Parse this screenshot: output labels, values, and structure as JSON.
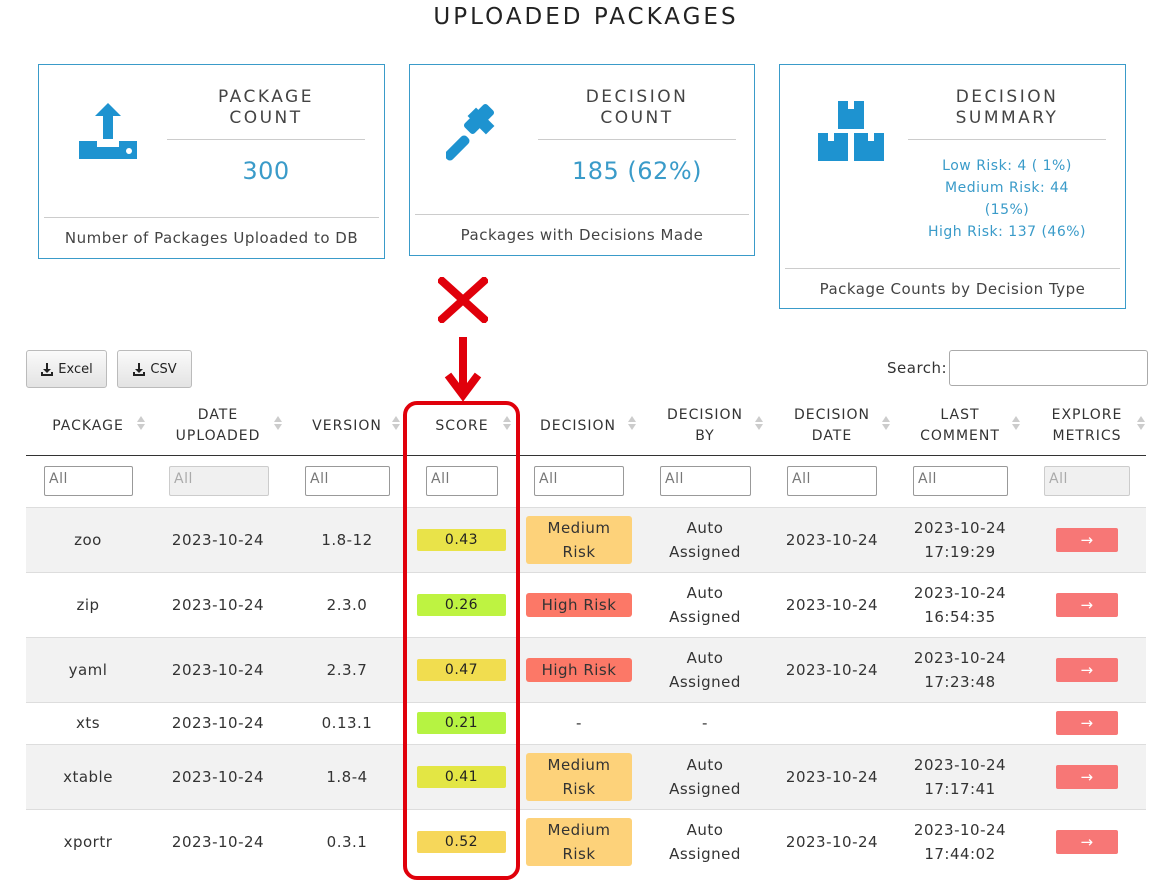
{
  "page": {
    "title": "UPLOADED PACKAGES"
  },
  "cards": {
    "package_count": {
      "title_line1": "PACKAGE",
      "title_line2": "COUNT",
      "value": "300",
      "footer": "Number of Packages Uploaded to DB",
      "icon": "upload-icon"
    },
    "decision_count": {
      "title_line1": "DECISION",
      "title_line2": "COUNT",
      "value": "185 (62%)",
      "footer": "Packages with Decisions Made",
      "icon": "gavel-icon"
    },
    "decision_summary": {
      "title_line1": "DECISION",
      "title_line2": "SUMMARY",
      "low": "Low Risk: 4 ( 1%)",
      "medium_line1": "Medium Risk: 44",
      "medium_line2": "(15%)",
      "high": "High Risk: 137 (46%)",
      "footer": "Package Counts by Decision Type",
      "icon": "boxes-icon"
    }
  },
  "toolbar": {
    "excel_label": "Excel",
    "csv_label": "CSV",
    "search_label": "Search:",
    "search_value": ""
  },
  "table": {
    "headers": {
      "package": "PACKAGE",
      "date_uploaded_1": "DATE",
      "date_uploaded_2": "UPLOADED",
      "version": "VERSION",
      "score": "SCORE",
      "decision": "DECISION",
      "decision_by_1": "DECISION",
      "decision_by_2": "BY",
      "decision_date_1": "DECISION",
      "decision_date_2": "DATE",
      "last_comment_1": "LAST",
      "last_comment_2": "COMMENT",
      "explore_1": "EXPLORE",
      "explore_2": "METRICS"
    },
    "filter_placeholder": "All",
    "rows": [
      {
        "package": "zoo",
        "date": "2023-10-24",
        "version": "1.8-12",
        "score": "0.43",
        "score_color": "#e9e349",
        "decision_1": "Medium",
        "decision_2": "Risk",
        "decision_color": "#fdd27a",
        "by_1": "Auto",
        "by_2": "Assigned",
        "decision_date": "2023-10-24",
        "comment_1": "2023-10-24",
        "comment_2": "17:19:29",
        "explore": "→"
      },
      {
        "package": "zip",
        "date": "2023-10-24",
        "version": "2.3.0",
        "score": "0.26",
        "score_color": "#bef341",
        "decision_1": "High Risk",
        "decision_2": "",
        "decision_color": "#fc7867",
        "by_1": "Auto",
        "by_2": "Assigned",
        "decision_date": "2023-10-24",
        "comment_1": "2023-10-24",
        "comment_2": "16:54:35",
        "explore": "→"
      },
      {
        "package": "yaml",
        "date": "2023-10-24",
        "version": "2.3.7",
        "score": "0.47",
        "score_color": "#f1dd4f",
        "decision_1": "High Risk",
        "decision_2": "",
        "decision_color": "#fc7867",
        "by_1": "Auto",
        "by_2": "Assigned",
        "decision_date": "2023-10-24",
        "comment_1": "2023-10-24",
        "comment_2": "17:23:48",
        "explore": "→"
      },
      {
        "package": "xts",
        "date": "2023-10-24",
        "version": "0.13.1",
        "score": "0.21",
        "score_color": "#b6f342",
        "decision_1": "-",
        "decision_2": "",
        "decision_color": "",
        "by_1": "-",
        "by_2": "",
        "decision_date": "",
        "comment_1": "",
        "comment_2": "",
        "explore": "→"
      },
      {
        "package": "xtable",
        "date": "2023-10-24",
        "version": "1.8-4",
        "score": "0.41",
        "score_color": "#e3e644",
        "decision_1": "Medium",
        "decision_2": "Risk",
        "decision_color": "#fdd27a",
        "by_1": "Auto",
        "by_2": "Assigned",
        "decision_date": "2023-10-24",
        "comment_1": "2023-10-24",
        "comment_2": "17:17:41",
        "explore": "→"
      },
      {
        "package": "xportr",
        "date": "2023-10-24",
        "version": "0.3.1",
        "score": "0.52",
        "score_color": "#f6d75a",
        "decision_1": "Medium",
        "decision_2": "Risk",
        "decision_color": "#fdd27a",
        "by_1": "Auto",
        "by_2": "Assigned",
        "decision_date": "2023-10-24",
        "comment_1": "2023-10-24",
        "comment_2": "17:44:02",
        "explore": "→"
      }
    ]
  },
  "annotation": {
    "highlight_color": "#e0000b",
    "marks": [
      "cross-icon",
      "arrow-down-icon"
    ]
  }
}
